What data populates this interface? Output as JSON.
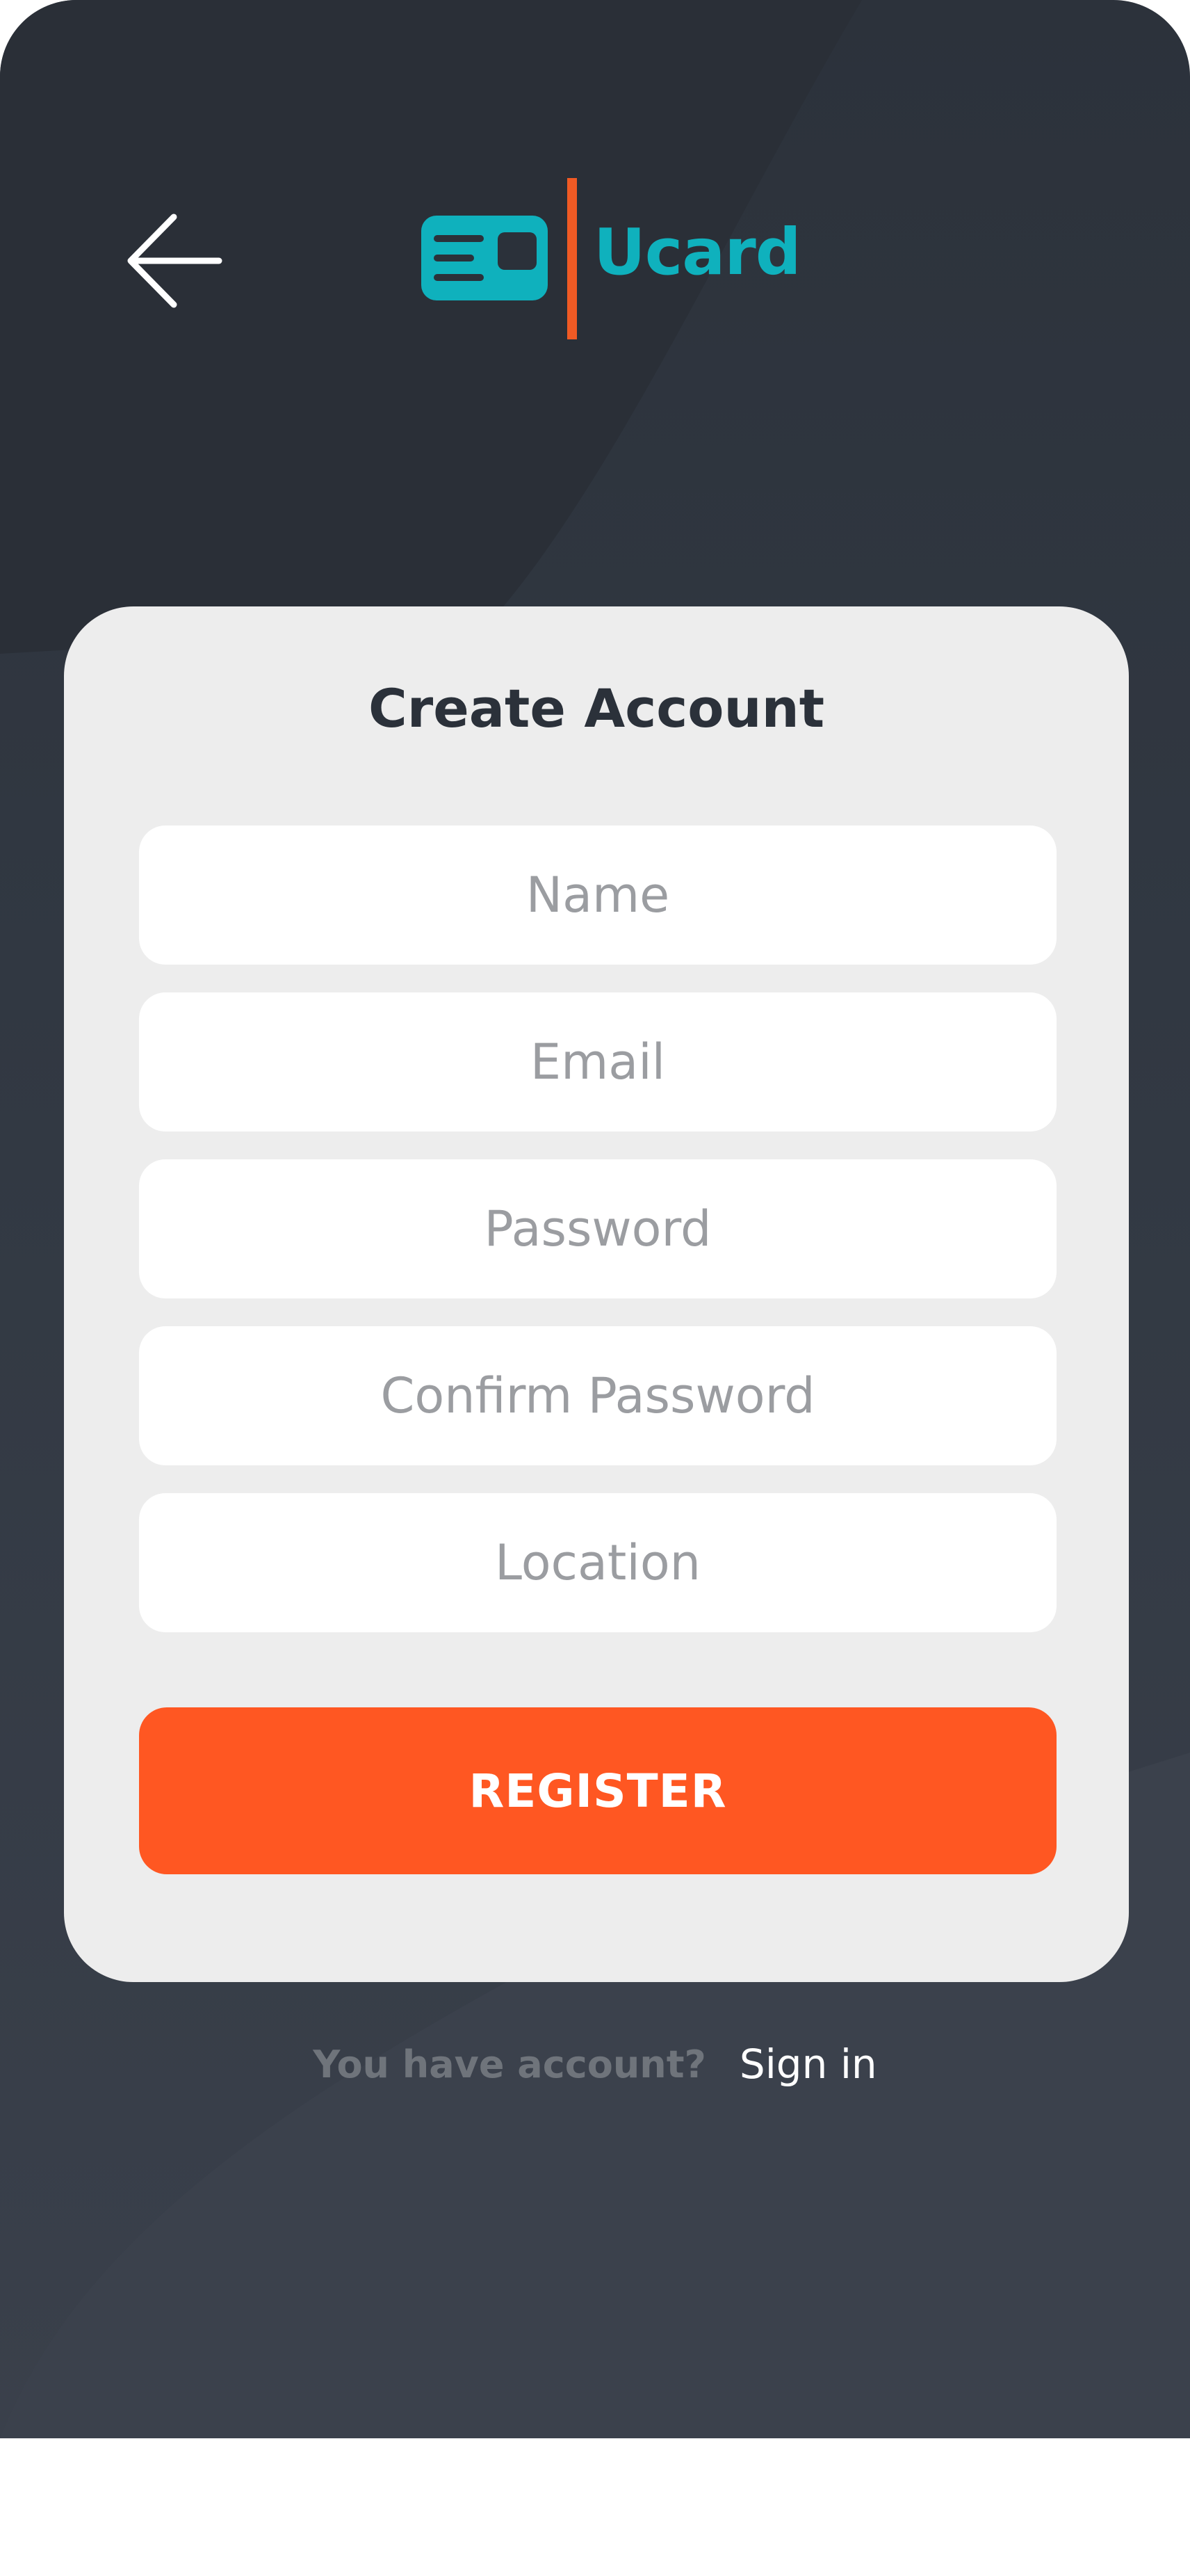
{
  "app": {
    "brand_name": "Ucard",
    "brand_color": "#0fb1bd",
    "accent_color": "#ff5722",
    "background_color": "#2c323b"
  },
  "header": {
    "back_icon": "arrow-left-icon",
    "logo_icon": "id-card-icon"
  },
  "form": {
    "title": "Create Account",
    "fields": [
      {
        "name": "name",
        "placeholder": "Name",
        "value": ""
      },
      {
        "name": "email",
        "placeholder": "Email",
        "value": ""
      },
      {
        "name": "password",
        "placeholder": "Password",
        "value": ""
      },
      {
        "name": "confirm_password",
        "placeholder": "Confirm Password",
        "value": ""
      },
      {
        "name": "location",
        "placeholder": "Location",
        "value": ""
      }
    ],
    "submit_label": "REGISTER"
  },
  "footer": {
    "prompt": "You have account?",
    "signin_label": "Sign in"
  }
}
